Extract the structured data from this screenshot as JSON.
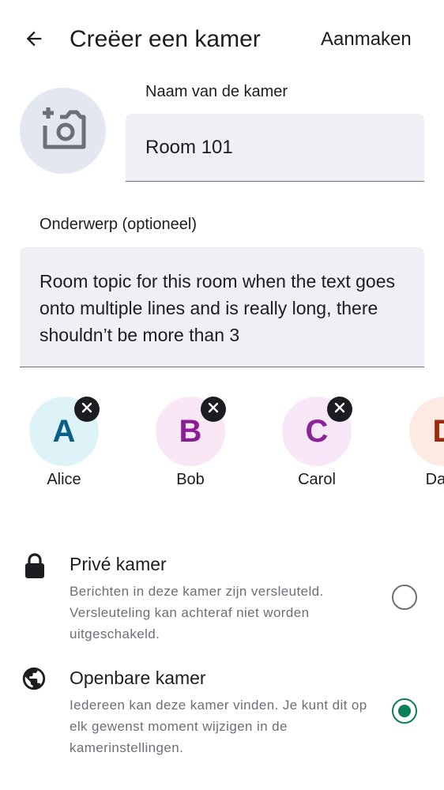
{
  "header": {
    "title": "Creëer een kamer",
    "create_label": "Aanmaken"
  },
  "room_name": {
    "label": "Naam van de kamer",
    "value": "Room 101"
  },
  "topic": {
    "label": "Onderwerp (optioneel)",
    "value": "Room topic for this room when the text goes onto multiple lines and is really long, there shouldn’t be more than 3"
  },
  "invitees": [
    {
      "initial": "A",
      "name": "Alice",
      "bg": "#ddf3f8",
      "fg": "#0a5f86"
    },
    {
      "initial": "B",
      "name": "Bob",
      "bg": "#f9e7f6",
      "fg": "#8b1d97"
    },
    {
      "initial": "C",
      "name": "Carol",
      "bg": "#f8e7f8",
      "fg": "#8a2597"
    },
    {
      "initial": "D",
      "name": "Dave",
      "bg": "#fdeae2",
      "fg": "#9b2a0a"
    }
  ],
  "options": {
    "private": {
      "title": "Privé kamer",
      "description": "Berichten in deze kamer zijn versleuteld. Versleuteling kan achteraf niet worden uitgeschakeld.",
      "selected": false
    },
    "public": {
      "title": "Openbare kamer",
      "description": "Iedereen kan deze kamer vinden. Je kunt dit op elk gewenst moment wijzigen in de kamerinstellingen.",
      "selected": true
    }
  },
  "colors": {
    "accent": "#0a7f58",
    "field_bg": "#eef0f5",
    "muted_text": "#6b6f78"
  }
}
